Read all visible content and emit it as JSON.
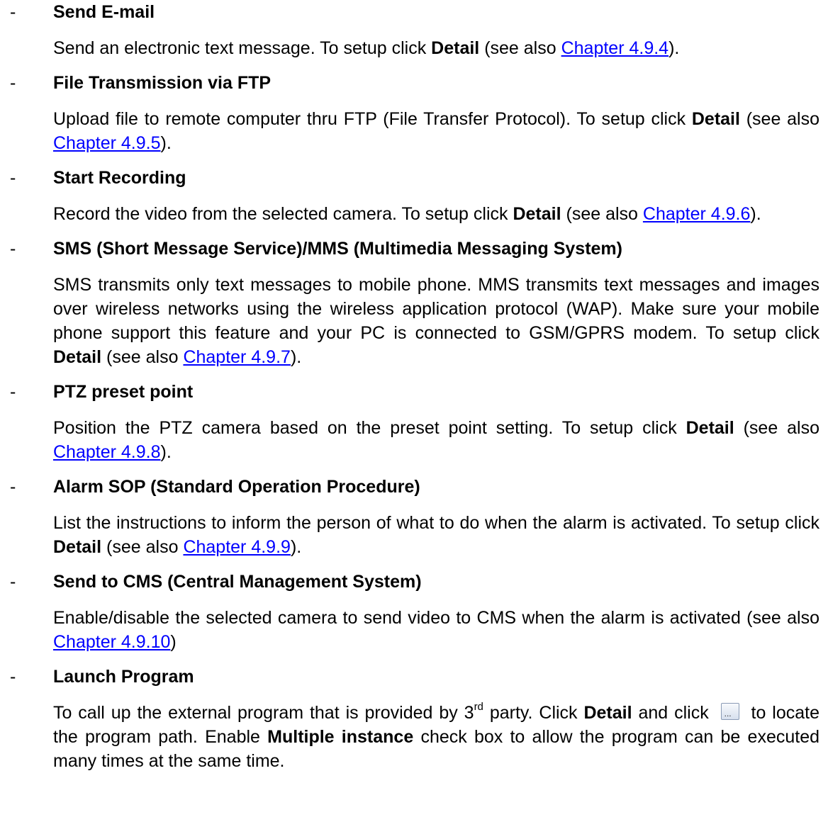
{
  "items": [
    {
      "title": "Send E-mail"
    },
    {
      "title": "File Transmission via FTP"
    },
    {
      "title": "Start Recording"
    },
    {
      "title": "SMS (Short Message Service)/MMS (Multimedia Messaging System)"
    },
    {
      "title": "PTZ preset point"
    },
    {
      "title": "Alarm SOP (Standard Operation Procedure)"
    },
    {
      "title": "Send to CMS (Central Management System)"
    },
    {
      "title": "Launch Program"
    }
  ],
  "common": {
    "dash": "-",
    "detail": "Detail",
    "see_also_open": "(see also ",
    "close_paren": ")",
    "close_paren_dot": ")."
  },
  "text": {
    "email_a": "Send an electronic text message. To setup click ",
    "email_link": "Chapter 4.9.4",
    "ftp_a": "Upload file to remote computer thru FTP (File Transfer Protocol). To setup click ",
    "ftp_link": "Chapter 4.9.5",
    "rec_a": "Record the video from the selected camera. To setup click ",
    "rec_link": "Chapter 4.9.6",
    "sms_a": "SMS transmits only text messages to mobile phone. MMS transmits text messages and images over wireless networks using the wireless application protocol (WAP). Make sure your mobile phone support this feature and your PC is connected to GSM/GPRS modem. To setup click ",
    "sms_link": "Chapter 4.9.7",
    "ptz_a": "Position the PTZ camera based on the preset point setting. To setup click ",
    "ptz_link": "Chapter 4.9.8",
    "sop_a": "List the instructions to inform the person of what to do when the alarm is activated. To setup click ",
    "sop_link": "Chapter 4.9.9",
    "cms_a": "Enable/disable the selected camera to send video to CMS when the alarm is activated (see also ",
    "cms_link": "Chapter 4.9.10",
    "launch_a": "To call up the external program that is provided by 3",
    "launch_sup": "rd",
    "launch_b": " party. Click ",
    "launch_c": " and click ",
    "launch_d": " to locate the program path. Enable ",
    "launch_bold2": "Multiple instance",
    "launch_e": " check box to allow the program can be executed many times at the same time."
  }
}
